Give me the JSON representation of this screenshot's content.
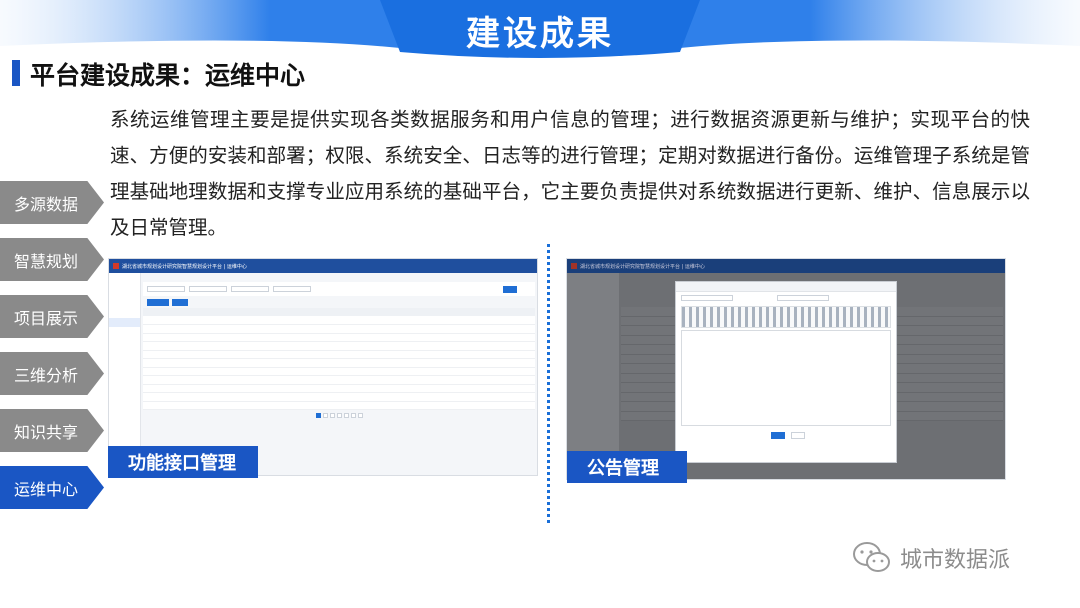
{
  "header": {
    "title": "建设成果"
  },
  "section": {
    "title": "平台建设成果：运维中心"
  },
  "body": {
    "paragraph": "系统运维管理主要是提供实现各类数据服务和用户信息的管理；进行数据资源更新与维护；实现平台的快速、方便的安装和部署；权限、系统安全、日志等的进行管理；定期对数据进行备份。运维管理子系统是管理基础地理数据和支撑专业应用系统的基础平台，它主要负责提供对系统数据进行更新、维护、信息展示以及日常管理。"
  },
  "side_nav": {
    "items": [
      {
        "label": "多源数据",
        "active": false
      },
      {
        "label": "智慧规划",
        "active": false
      },
      {
        "label": "项目展示",
        "active": false
      },
      {
        "label": "三维分析",
        "active": false
      },
      {
        "label": "知识共享",
        "active": false
      },
      {
        "label": "运维中心",
        "active": true
      }
    ]
  },
  "screenshots": {
    "left": {
      "app_title": "湖北省城市规划设计研究院智慧规划设计平台 | 运维中心",
      "caption": "功能接口管理"
    },
    "right": {
      "app_title": "湖北省城市规划设计研究院智慧规划设计平台 | 运维中心",
      "caption": "公告管理"
    }
  },
  "watermark": {
    "text": "城市数据派",
    "icon": "wechat-icon"
  },
  "colors": {
    "accent": "#1a56c4",
    "inactive_nav": "#8a8a8a",
    "banner": "#1a6fe0"
  }
}
